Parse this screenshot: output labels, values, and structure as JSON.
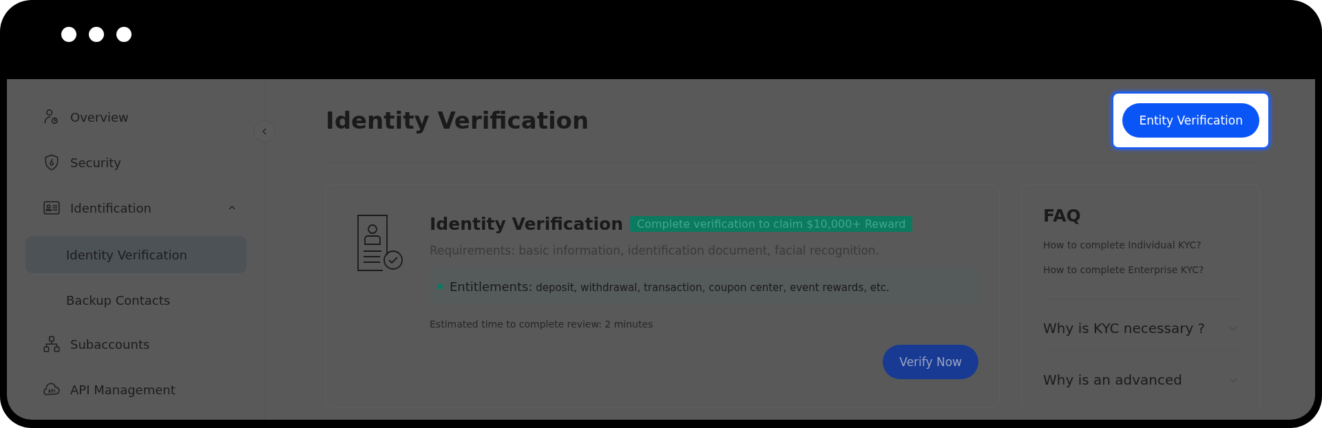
{
  "sidebar": {
    "items": [
      {
        "kind": "overview",
        "label": "Overview",
        "selected": false
      },
      {
        "kind": "security",
        "label": "Security",
        "selected": false
      },
      {
        "kind": "identification",
        "label": "Identification",
        "selected": false,
        "expanded": true,
        "children": [
          {
            "label": "Identity Verification",
            "selected": true
          },
          {
            "label": "Backup Contacts",
            "selected": false
          }
        ]
      },
      {
        "kind": "subaccounts",
        "label": "Subaccounts",
        "selected": false
      },
      {
        "kind": "api",
        "label": "API Management",
        "selected": false
      }
    ]
  },
  "header": {
    "title": "Identity Verification",
    "action": {
      "label": "Entity Verification",
      "highlighted": true
    }
  },
  "card": {
    "title": "Identity Verification",
    "badge": "Complete verification to claim $10,000+ Reward",
    "requirements": "Requirements: basic information, identification document, facial recognition.",
    "entitlements": "**Entitlements:** deposit, withdrawal, transaction, coupon center, event rewards, etc.",
    "estimate": "Estimated time to complete review: 2 minutes",
    "button": "Verify Now"
  },
  "faq": {
    "title": "FAQ",
    "links": [
      "How to complete Individual KYC?",
      "How to complete Enterprise KYC?"
    ],
    "questions": [
      {
        "text": "Why is KYC necessary ?",
        "expanded": false
      },
      {
        "text": "Why is an advanced",
        "expanded": false
      }
    ]
  }
}
